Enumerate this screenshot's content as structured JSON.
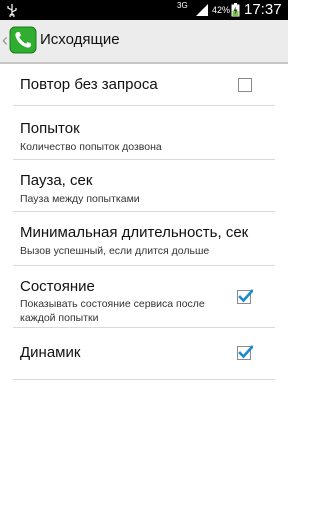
{
  "status_bar": {
    "network": "3G",
    "battery": "42%",
    "time": "17:37",
    "icons": [
      "usb-icon",
      "signal-icon",
      "battery-charging-icon"
    ]
  },
  "action_bar": {
    "title": "Исходящие",
    "app_icon": "phone-icon",
    "back_icon": "back-chevron-icon"
  },
  "settings": [
    {
      "title": "Повтор без запроса",
      "summary": "",
      "checkbox": true,
      "checked": false
    },
    {
      "title": "Попыток",
      "summary": "Количество попыток дозвона"
    },
    {
      "title": "Пауза, сек",
      "summary": "Пауза между попытками"
    },
    {
      "title": "Минимальная длительность, сек",
      "summary": "Вызов успешный, если длится дольше"
    },
    {
      "title": "Состояние",
      "summary_line1": "Показывать состояние сервиса после",
      "summary_line2": "каждой попытки",
      "checkbox": true,
      "checked": true
    },
    {
      "title": "Динамик",
      "summary": "",
      "checkbox": true,
      "checked": true
    }
  ],
  "colors": {
    "check_accent": "#1a8ad4",
    "phone_green": "#2fae2f",
    "action_bar_bg": "#ececec"
  }
}
